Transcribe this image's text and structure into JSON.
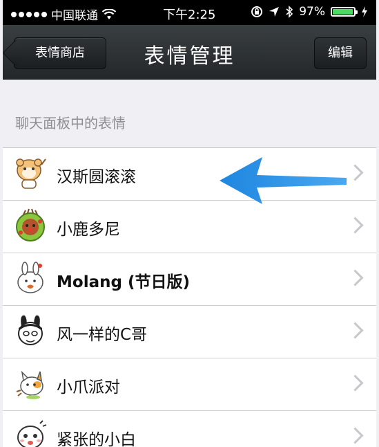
{
  "status_bar": {
    "carrier": "中国联通",
    "time": "下午2:25",
    "battery_percent": "97%",
    "battery_level": 0.97,
    "icons": [
      "signal-dots-icon",
      "wifi-icon",
      "rotation-lock-icon",
      "location-icon",
      "bluetooth-icon",
      "battery-icon"
    ]
  },
  "nav": {
    "back_label": "表情商店",
    "title": "表情管理",
    "edit_label": "编辑"
  },
  "section": {
    "header": "聊天面板中的表情"
  },
  "stickers": [
    {
      "name": "汉斯圆滚滚",
      "icon": "hamster-sticker-icon"
    },
    {
      "name": "小鹿多尼",
      "icon": "deer-sticker-icon"
    },
    {
      "name": "Molang (节日版)",
      "icon": "rabbit-sticker-icon"
    },
    {
      "name": "风一样的C哥",
      "icon": "bunny-face-sticker-icon"
    },
    {
      "name": "小爪派对",
      "icon": "cat-sticker-icon"
    },
    {
      "name": "紧张的小白",
      "icon": "white-face-sticker-icon"
    }
  ],
  "colors": {
    "navbar": "#2b3033",
    "background": "#efeff4",
    "arrow": "#2a8fe6"
  }
}
